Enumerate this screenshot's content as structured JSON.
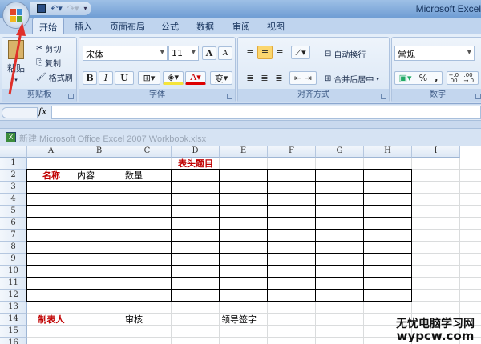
{
  "app_title": "Microsoft Excel",
  "quick_access": {
    "save_icon": "save-icon",
    "undo_icon": "undo-icon",
    "redo_icon": "redo-icon",
    "customize_icon": "chevron-down-icon"
  },
  "tabs": [
    {
      "label": "开始",
      "active": true
    },
    {
      "label": "插入"
    },
    {
      "label": "页面布局"
    },
    {
      "label": "公式"
    },
    {
      "label": "数据"
    },
    {
      "label": "审阅"
    },
    {
      "label": "视图"
    }
  ],
  "ribbon": {
    "clipboard": {
      "label": "剪贴板",
      "paste": "粘贴",
      "cut": "剪切",
      "copy": "复制",
      "format_painter": "格式刷"
    },
    "font": {
      "label": "字体",
      "font_name": "宋体",
      "font_size": "11",
      "bold": "B",
      "italic": "I",
      "underline": "U",
      "font_color_glyph": "A",
      "grow": "A",
      "shrink": "A",
      "phonetic": "变"
    },
    "alignment": {
      "label": "对齐方式",
      "wrap_text": "自动换行",
      "merge_center": "合并后居中"
    },
    "number": {
      "label": "数字",
      "format": "常规",
      "percent": "%",
      "comma": ",",
      "inc_decimal": "+.0 .00",
      "dec_decimal": ".00 →.0"
    }
  },
  "formula_bar": {
    "fx": "fx",
    "value": ""
  },
  "workbook_title": "新建 Microsoft Office Excel 2007 Workbook.xlsx",
  "columns": [
    "A",
    "B",
    "C",
    "D",
    "E",
    "F",
    "G",
    "H",
    "I"
  ],
  "rows": [
    "1",
    "2",
    "3",
    "4",
    "5",
    "6",
    "7",
    "8",
    "9",
    "10",
    "11",
    "12",
    "13",
    "14",
    "15",
    "16"
  ],
  "cells": {
    "D1": "表头题目",
    "A2": "名称",
    "B2": "内容",
    "C2": "数量",
    "A14": "制表人",
    "C14": "审核",
    "E14": "领导签字"
  },
  "watermark": {
    "line1": "无忧电脑学习网",
    "line2": "wypcw.com"
  },
  "colors": {
    "accent_red": "#c00000",
    "annotation_arrow": "#e0302a"
  }
}
